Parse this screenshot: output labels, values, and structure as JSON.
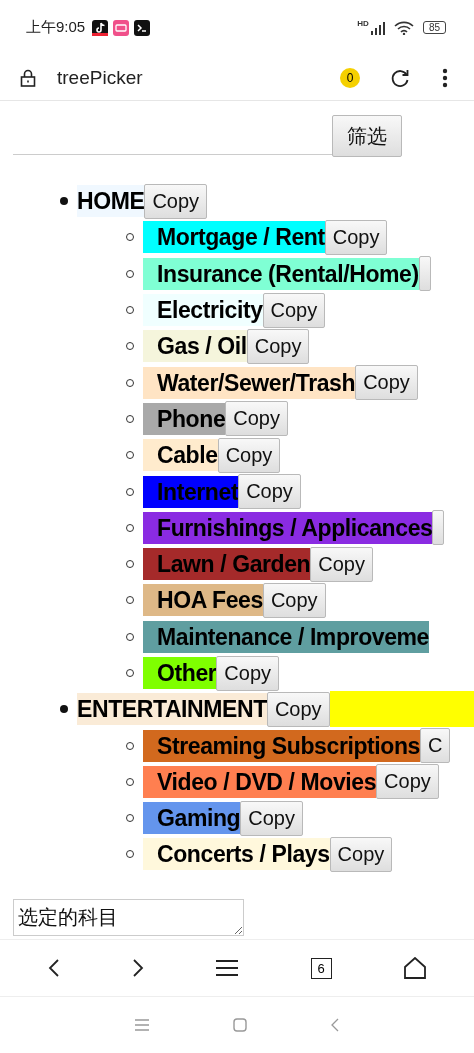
{
  "status_bar": {
    "time": "上午9:05",
    "network": "HD",
    "battery": "85"
  },
  "browser": {
    "title": "treePicker",
    "badge": "0",
    "tab_count": "6"
  },
  "filter": {
    "button": "筛选"
  },
  "categories": [
    {
      "label": "HOME",
      "color": "#f0f8ff",
      "copy": "Copy",
      "items": [
        {
          "label": "Mortgage / Rent",
          "color": "#00ffff",
          "copy": "Copy"
        },
        {
          "label": "Insurance (Rental/Home)",
          "color": "#7fffd4",
          "copy_edge": true
        },
        {
          "label": "Electricity",
          "color": "#f0ffff",
          "copy": "Copy"
        },
        {
          "label": "Gas / Oil",
          "color": "#f5f5dc",
          "copy": "Copy"
        },
        {
          "label": "Water/Sewer/Trash",
          "color": "#ffe4c4",
          "copy": "Copy"
        },
        {
          "label": "Phone",
          "color": "#a9a9a9",
          "copy": "Copy"
        },
        {
          "label": "Cable",
          "color": "#ffebcd",
          "copy": "Copy"
        },
        {
          "label": "Internet",
          "color": "#0000ff",
          "copy": "Copy"
        },
        {
          "label": "Furnishings / Applicances",
          "color": "#8a2be2",
          "copy_edge": true
        },
        {
          "label": "Lawn / Garden",
          "color": "#a52a2a",
          "copy": "Copy"
        },
        {
          "label": "HOA Fees",
          "color": "#deb887",
          "copy": "Copy"
        },
        {
          "label": "Maintenance / Improveme",
          "color": "#5f9ea0"
        },
        {
          "label": "Other",
          "color": "#7fff00",
          "copy": "Copy"
        }
      ]
    },
    {
      "label": "ENTERTAINMENT",
      "color": "#faebd7",
      "band": {
        "color": "#ffff00"
      },
      "copy": "Copy",
      "items": [
        {
          "label": "Streaming Subscriptions",
          "color": "#d2691e",
          "copy": "C"
        },
        {
          "label": "Video / DVD / Movies",
          "color": "#ff7f50",
          "copy": "Copy"
        },
        {
          "label": "Gaming",
          "color": "#6495ed",
          "copy": "Copy"
        },
        {
          "label": "Concerts / Plays",
          "color": "#fff8dc",
          "copy": "Copy"
        }
      ]
    }
  ],
  "selection": {
    "value": "选定的科目"
  }
}
